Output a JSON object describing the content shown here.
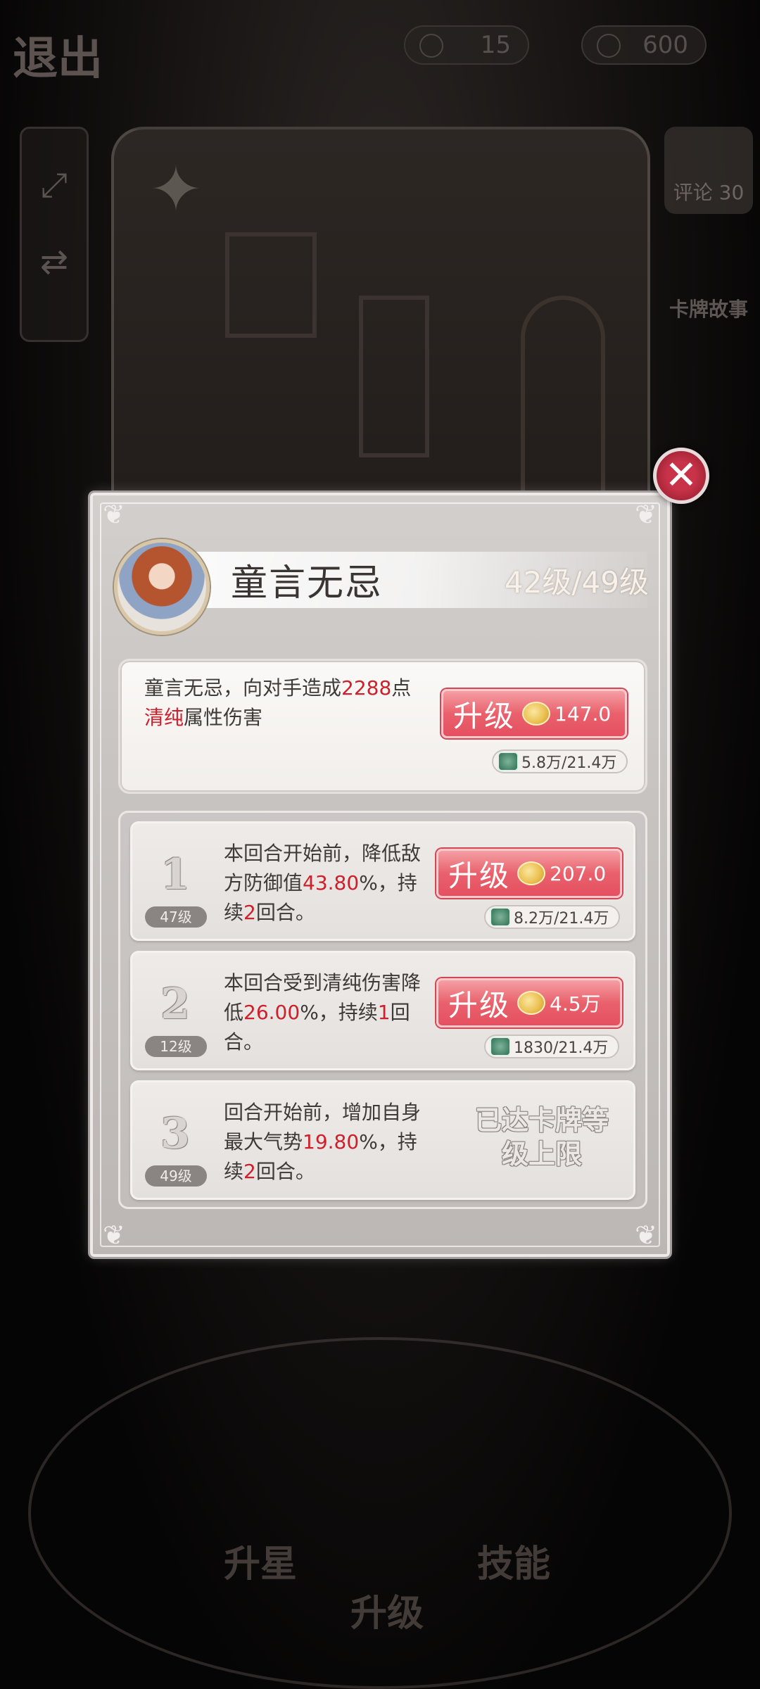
{
  "topbar": {
    "exit_label": "退出",
    "currency_1": "15",
    "currency_2": "600"
  },
  "side": {
    "comment_label": "评论 30",
    "story_label": "卡牌故事"
  },
  "bottom_nav": [
    "升星",
    "升级",
    "技能"
  ],
  "card": {
    "name": "童言无忌",
    "level": "42级/49级"
  },
  "main_skill": {
    "desc_a": "童言无忌，向对手造成",
    "damage": "2288",
    "desc_b": "点",
    "element": "清纯",
    "desc_c": "属性伤害",
    "upgrade_label": "升级",
    "cost": "147.0",
    "resource": "5.8万/21.4万"
  },
  "sub_skills": [
    {
      "index": "1",
      "level": "47级",
      "desc_a": "本回合开始前，降低敌方防御值",
      "value": "43.80",
      "desc_b": "%，持续",
      "turns": "2",
      "desc_c": "回合。",
      "upgrade_label": "升级",
      "cost": "207.0",
      "resource": "8.2万/21.4万"
    },
    {
      "index": "2",
      "level": "12级",
      "desc_a": "本回合受到清纯伤害降低",
      "value": "26.00",
      "desc_b": "%，持续",
      "turns": "1",
      "desc_c": "回合。",
      "upgrade_label": "升级",
      "cost": "4.5万",
      "resource": "1830/21.4万"
    },
    {
      "index": "3",
      "level": "49级",
      "desc_a": "回合开始前，增加自身最大气势",
      "value": "19.80",
      "desc_b": "%，持续",
      "turns": "2",
      "desc_c": "回合。",
      "maxed_label": "已达卡牌等级上限"
    }
  ],
  "colors": {
    "accent_red": "#cf1f2b",
    "upgrade_button": "#e9616c",
    "panel": "#c7c3c1"
  }
}
